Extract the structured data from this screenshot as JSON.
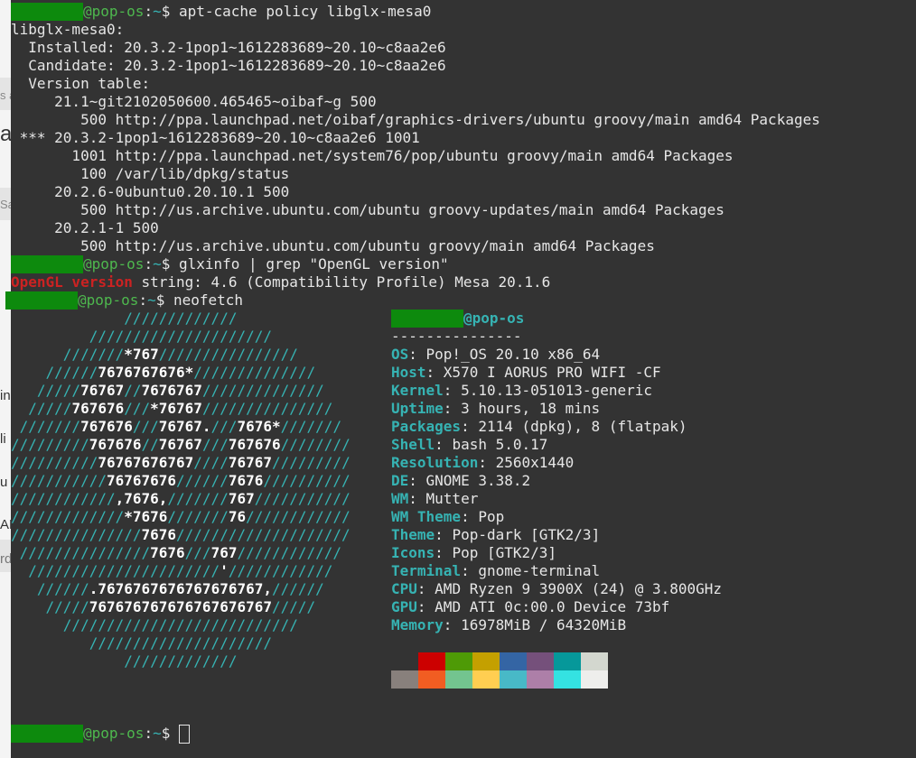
{
  "prompt": {
    "host": "@pop-os",
    "path": "~",
    "dollar": "$ "
  },
  "commands": {
    "c1": "apt-cache policy libglx-mesa0",
    "c2": "glxinfo | grep \"OpenGL version\"",
    "c3": "neofetch"
  },
  "policy_lines": [
    "libglx-mesa0:",
    "  Installed: 20.3.2-1pop1~1612283689~20.10~c8aa2e6",
    "  Candidate: 20.3.2-1pop1~1612283689~20.10~c8aa2e6",
    "  Version table:",
    "     21.1~git2102050600.465465~oibaf~g 500",
    "        500 http://ppa.launchpad.net/oibaf/graphics-drivers/ubuntu groovy/main amd64 Packages",
    " *** 20.3.2-1pop1~1612283689~20.10~c8aa2e6 1001",
    "       1001 http://ppa.launchpad.net/system76/pop/ubuntu groovy/main amd64 Packages",
    "        100 /var/lib/dpkg/status",
    "     20.2.6-0ubuntu0.20.10.1 500",
    "        500 http://us.archive.ubuntu.com/ubuntu groovy-updates/main amd64 Packages",
    "     20.2.1-1 500",
    "        500 http://us.archive.ubuntu.com/ubuntu groovy/main amd64 Packages"
  ],
  "glx": {
    "highlight": "OpenGL version",
    "rest": " string: 4.6 (Compatibility Profile) Mesa 20.1.6"
  },
  "logo": [
    "             /////////////",
    "         /////////////////////",
    "      ///////*767////////////////",
    "    //////7676767676*//////////////",
    "   /////76767//7676767//////////////",
    "  /////767676///*76767///////////////",
    " ///////767676///76767.///7676*///////",
    "/////////767676//76767///767676////////",
    "//////////76767676767////76767/////////",
    "///////////76767676//////7676//////////",
    "////////////,7676,///////767///////////",
    "/////////////*7676///////76////////////",
    "///////////////7676////////////////////",
    " ///////////////7676///767////////////",
    "  //////////////////////'////////////",
    "   //////.7676767676767676767,//////",
    "    /////767676767676767676767/////",
    "      ///////////////////////////",
    "         /////////////////////",
    "             /////////////"
  ],
  "info": {
    "host": "@pop-os",
    "sep": "---------------",
    "rows": [
      {
        "label": "OS",
        "value": "Pop!_OS 20.10 x86_64"
      },
      {
        "label": "Host",
        "value": "X570 I AORUS PRO WIFI -CF"
      },
      {
        "label": "Kernel",
        "value": "5.10.13-051013-generic"
      },
      {
        "label": "Uptime",
        "value": "3 hours, 18 mins"
      },
      {
        "label": "Packages",
        "value": "2114 (dpkg), 8 (flatpak)"
      },
      {
        "label": "Shell",
        "value": "bash 5.0.17"
      },
      {
        "label": "Resolution",
        "value": "2560x1440"
      },
      {
        "label": "DE",
        "value": "GNOME 3.38.2"
      },
      {
        "label": "WM",
        "value": "Mutter"
      },
      {
        "label": "WM Theme",
        "value": "Pop"
      },
      {
        "label": "Theme",
        "value": "Pop-dark [GTK2/3]"
      },
      {
        "label": "Icons",
        "value": "Pop [GTK2/3]"
      },
      {
        "label": "Terminal",
        "value": "gnome-terminal"
      },
      {
        "label": "CPU",
        "value": "AMD Ryzen 9 3900X (24) @ 3.800GHz"
      },
      {
        "label": "GPU",
        "value": "AMD ATI 0c:00.0 Device 73bf"
      },
      {
        "label": "Memory",
        "value": "16978MiB / 64320MiB"
      }
    ]
  },
  "palette": {
    "top": [
      "#333333",
      "#cc0000",
      "#4e9a06",
      "#c4a000",
      "#3465a4",
      "#75507b",
      "#06989a",
      "#d3d7cf"
    ],
    "bottom": [
      "#88807c",
      "#f15d22",
      "#73c48f",
      "#ffce51",
      "#48b9c7",
      "#ad7fa8",
      "#34e2e2",
      "#eeeeec"
    ]
  },
  "background_fragments": [
    "s a",
    "a",
    "Sa",
    "in",
    "li",
    "u",
    "AN",
    "rd"
  ],
  "colors": {
    "terminal_bg": "#333333",
    "prompt_green": "#4eb84e",
    "teal": "#36b3b3",
    "error_red": "#cc2222"
  }
}
